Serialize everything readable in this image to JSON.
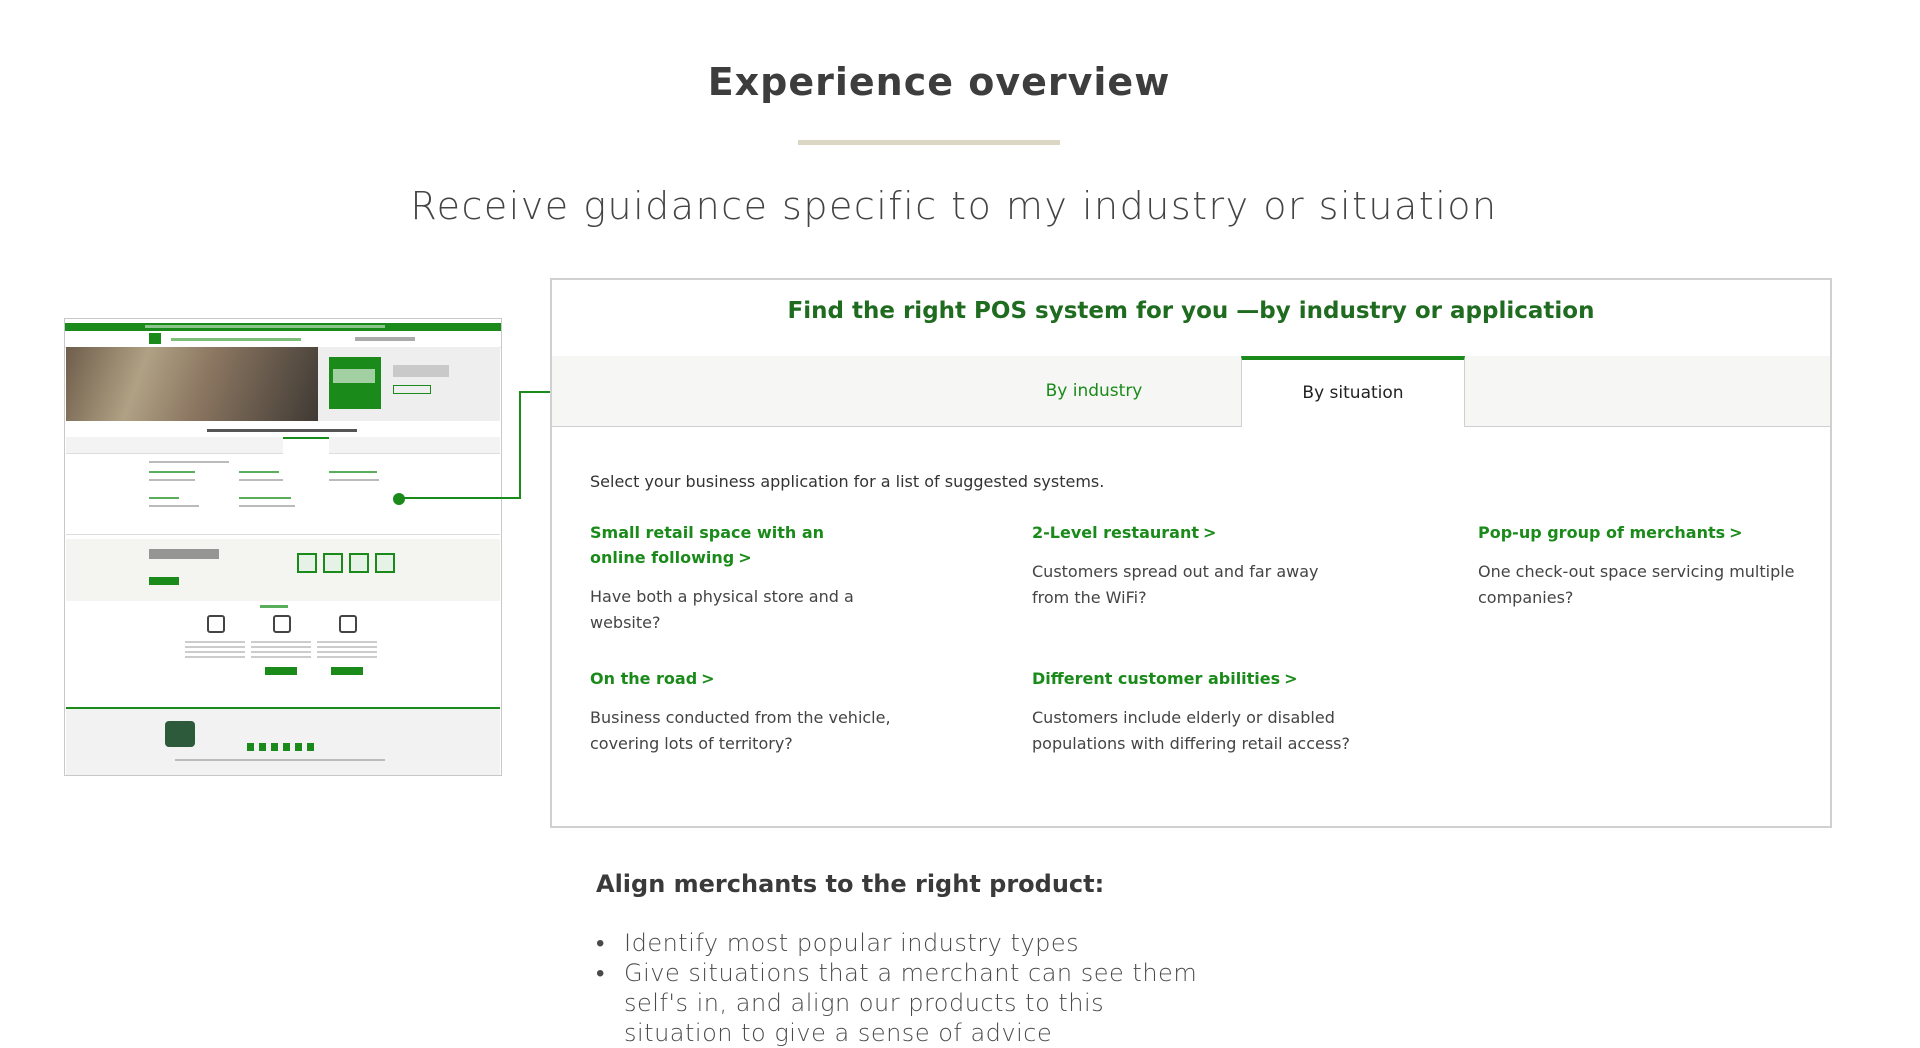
{
  "page": {
    "heading": "Experience overview",
    "subheading": "Receive guidance specific to my industry or situation"
  },
  "panel": {
    "title": "Find the right POS system for you —by industry or application",
    "tabs": [
      {
        "label": "By industry",
        "active": false
      },
      {
        "label": "By situation",
        "active": true
      }
    ],
    "intro": "Select your business application for a list of suggested systems.",
    "items": [
      {
        "link": "Small retail space with an online following",
        "desc": "Have both a physical store and a website?"
      },
      {
        "link": "2-Level restaurant",
        "desc": "Customers spread out and far away from the WiFi?"
      },
      {
        "link": "Pop-up group of merchants",
        "desc": "One check-out space servicing multiple companies?"
      },
      {
        "link": "On the road",
        "desc": "Business conducted from the vehicle, covering lots of territory?"
      },
      {
        "link": "Different customer abilities",
        "desc": "Customers include elderly or disabled populations with differing retail access?"
      }
    ],
    "chevron": ">"
  },
  "notes": {
    "title": "Align merchants to the right product:",
    "bullets": [
      "Identify most popular industry types",
      "Give situations that a merchant can see them self's in, and align our products to this situation to give a sense of advice"
    ]
  },
  "colors": {
    "brand_green": "#1a8b1a",
    "title_green": "#1f6b1f",
    "divider": "#dbd7c4"
  },
  "icons": [
    "arrow-right-icon",
    "chevron-right-icon"
  ]
}
